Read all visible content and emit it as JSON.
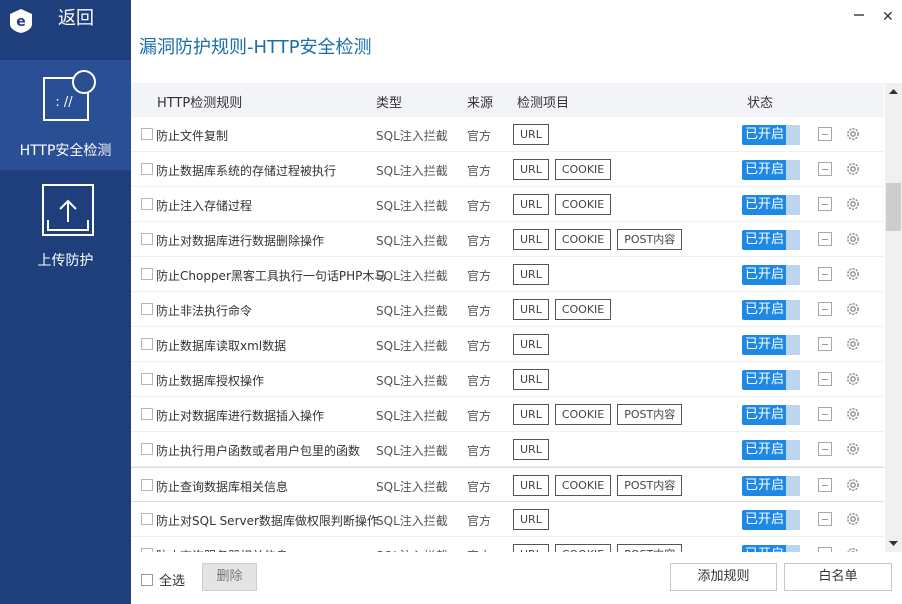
{
  "sidebar": {
    "back_label": "返回",
    "items": [
      {
        "label": "HTTP安全检测",
        "active": true,
        "icon": "web-security-icon"
      },
      {
        "label": "上传防护",
        "active": false,
        "icon": "upload-icon"
      }
    ]
  },
  "window": {
    "title": "漏洞防护规则-HTTP安全检测",
    "close_glyph": "✕"
  },
  "table": {
    "columns": [
      "HTTP检测规则",
      "类型",
      "来源",
      "检测项目",
      "状态"
    ],
    "rows": [
      {
        "name": "防止文件复制",
        "type": "SQL注入拦截",
        "source": "官方",
        "tags": [
          "URL"
        ],
        "status": "已开启"
      },
      {
        "name": "防止数据库系统的存储过程被执行",
        "type": "SQL注入拦截",
        "source": "官方",
        "tags": [
          "URL",
          "COOKIE"
        ],
        "status": "已开启"
      },
      {
        "name": "防止注入存储过程",
        "type": "SQL注入拦截",
        "source": "官方",
        "tags": [
          "URL",
          "COOKIE"
        ],
        "status": "已开启"
      },
      {
        "name": "防止对数据库进行数据删除操作",
        "type": "SQL注入拦截",
        "source": "官方",
        "tags": [
          "URL",
          "COOKIE",
          "POST内容"
        ],
        "status": "已开启"
      },
      {
        "name": "防止Chopper黑客工具执行一句话PHP木马",
        "type": "SQL注入拦截",
        "source": "官方",
        "tags": [
          "URL"
        ],
        "status": "已开启"
      },
      {
        "name": "防止非法执行命令",
        "type": "SQL注入拦截",
        "source": "官方",
        "tags": [
          "URL",
          "COOKIE"
        ],
        "status": "已开启"
      },
      {
        "name": "防止数据库读取xml数据",
        "type": "SQL注入拦截",
        "source": "官方",
        "tags": [
          "URL"
        ],
        "status": "已开启"
      },
      {
        "name": "防止数据库授权操作",
        "type": "SQL注入拦截",
        "source": "官方",
        "tags": [
          "URL"
        ],
        "status": "已开启"
      },
      {
        "name": "防止对数据库进行数据插入操作",
        "type": "SQL注入拦截",
        "source": "官方",
        "tags": [
          "URL",
          "COOKIE",
          "POST内容"
        ],
        "status": "已开启"
      },
      {
        "name": "防止执行用户函数或者用户包里的函数",
        "type": "SQL注入拦截",
        "source": "官方",
        "tags": [
          "URL"
        ],
        "status": "已开启"
      },
      {
        "name": "防止查询数据库相关信息",
        "type": "SQL注入拦截",
        "source": "官方",
        "tags": [
          "URL",
          "COOKIE",
          "POST内容"
        ],
        "status": "已开启"
      },
      {
        "name": "防止对SQL Server数据库做权限判断操作",
        "type": "SQL注入拦截",
        "source": "官方",
        "tags": [
          "URL"
        ],
        "status": "已开启"
      },
      {
        "name": "防止查询服务器相关信息",
        "type": "SQL注入拦截",
        "source": "官方",
        "tags": [
          "URL",
          "COOKIE",
          "POST内容"
        ],
        "status": "已开启"
      }
    ]
  },
  "footer": {
    "select_all_label": "全选",
    "delete_label": "删除",
    "add_rule_label": "添加规则",
    "whitelist_label": "白名单"
  },
  "colors": {
    "sidebar": "#1f3f7c",
    "sidebar_active": "#2a4f95",
    "accent": "#1e88e5",
    "title": "#1b6ea8"
  }
}
